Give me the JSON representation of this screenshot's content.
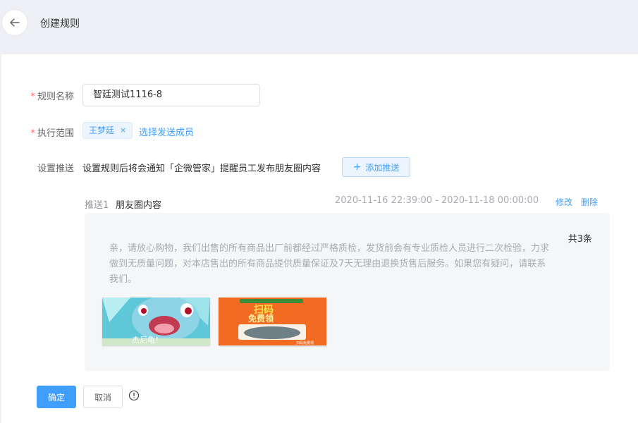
{
  "header": {
    "title": "创建规则"
  },
  "form": {
    "name": {
      "required_mark": "*",
      "label": "规则名称",
      "value": "智廷测试1116-8"
    },
    "scope": {
      "required_mark": "*",
      "label": "执行范围",
      "tags": [
        {
          "label": "王梦廷",
          "close": "×"
        }
      ],
      "select_link": "选择发送成员"
    },
    "push": {
      "label": "设置推送",
      "description": "设置规则后将会通知「企微管家」提醒员工发布朋友圈内容",
      "add_button": "添加推送",
      "add_icon": "+"
    }
  },
  "push_item": {
    "index": "推送1",
    "type": "朋友圈内容",
    "time_range": "2020-11-16 22:39:00 - 2020-11-18 00:00:00",
    "edit": "修改",
    "delete": "删除",
    "count": "共3条",
    "text": "亲，请放心购物，我们出售的所有商品出厂前都经过严格质检，发货前会有专业质检人员进行二次检验，力求做到无质量问题，对本店售出的所有商品提供质量保证及7天无理由退换货售后服务。如果您有疑问，请联系我们。",
    "images": [
      {
        "icon": "cartoon-character-image",
        "caption": "杰尼龟！"
      },
      {
        "icon": "scan-promo-poster-image",
        "headline": "扫码",
        "subline": "免费领",
        "footer": "扫码免费领"
      }
    ]
  },
  "actions": {
    "confirm": "确定",
    "cancel": "取消",
    "info_icon": "info-icon"
  },
  "colors": {
    "primary": "#409eff",
    "required": "#f56c6c",
    "background": "#eff0f5",
    "panel": "#f5f6f8"
  }
}
